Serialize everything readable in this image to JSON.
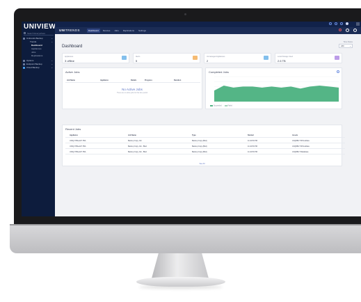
{
  "app": {
    "logo": "UNIVIEW",
    "brand_bold": "UNI",
    "brand_rest": "TRENDS",
    "search_placeholder": "Search Everywhere"
  },
  "sidebar": {
    "items": [
      {
        "label": "Unitrends Backup"
      },
      {
        "label": "Trends"
      },
      {
        "label": "Options"
      },
      {
        "label": "Endpoint Backup"
      },
      {
        "label": "Cloud Backup"
      }
    ],
    "subitems": [
      {
        "label": "Dashboard"
      },
      {
        "label": "Appliances"
      },
      {
        "label": "Jobs"
      },
      {
        "label": "Replications"
      }
    ]
  },
  "nav": {
    "tabs": [
      "Dashboard",
      "Devices",
      "Jobs",
      "Replications",
      "Settings"
    ]
  },
  "page": {
    "title": "Dashboard",
    "range_label": "Time Frame",
    "range_value": "24h"
  },
  "stats": [
    {
      "label": "Appliances",
      "value": "3 offline",
      "color": "#5aa9e6"
    },
    {
      "label": "Alerts",
      "value": "5",
      "color": "#f2a444"
    },
    {
      "label": "Unmanaged Appliances",
      "value": "2",
      "color": "#5aa9e6"
    },
    {
      "label": "Local Storage Used",
      "value": "2.6 TB",
      "color": "#a57be0"
    }
  ],
  "active_jobs": {
    "title": "Active Jobs",
    "columns": [
      "Job Name",
      "Appliance",
      "Details",
      "Progress",
      "Duration"
    ],
    "empty_title": "No Active Jobs",
    "empty_sub": "There are no active jobs for this time period"
  },
  "completed_jobs": {
    "title": "Completed Jobs",
    "chart_data": {
      "type": "area",
      "series": [
        {
          "name": "Succeeded",
          "color": "#54b586",
          "values": [
            11,
            16,
            14,
            15,
            15,
            14,
            15,
            14,
            15,
            13,
            15,
            16,
            15,
            14
          ]
        },
        {
          "name": "Failed",
          "color": "#a8d5bd",
          "values": [
            1,
            1,
            1,
            1,
            1,
            1,
            1,
            1,
            1,
            1,
            1,
            1,
            1,
            1
          ]
        }
      ],
      "ylim": [
        0,
        25
      ],
      "grid": true,
      "legend": "bottom-left"
    }
  },
  "recent_jobs": {
    "title": "Recent Jobs",
    "columns": [
      "Appliance",
      "Job Name",
      "Type",
      "Started",
      "Assets"
    ],
    "rows": [
      [
        "UNIQ-TrBlueUP-7BA",
        "Backup Copy Job",
        "Backup Copy (Bkd)",
        "11:44:50 PM",
        "LSQDB2.TrPrimeData"
      ],
      [
        "UNIQ-TrBlueUP-7BA",
        "Backup Copy Job - Blod",
        "Backup Copy (Bkd)",
        "11:44:50 PM",
        "LSQDB2.TrPrimeData"
      ],
      [
        "UNIQ-TrBlueUP-7BA",
        "Backup Copy Job - Blod",
        "Backup Copy (Bkd)",
        "11:44:50 PM",
        "LSQDB2.TrDatabase"
      ]
    ],
    "see_all": "See All"
  }
}
